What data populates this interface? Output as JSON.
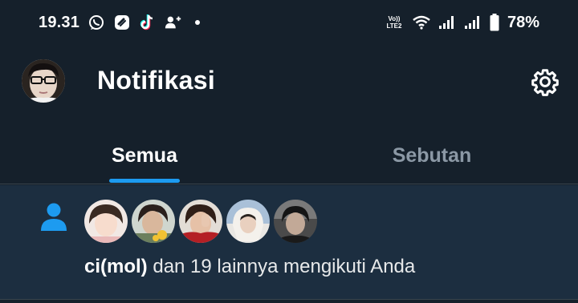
{
  "status_bar": {
    "time": "19.31",
    "battery": "78%",
    "icons": [
      "whatsapp-icon",
      "link-app-icon",
      "tiktok-icon",
      "add-person-icon",
      "notification-dot",
      "volte-icon",
      "wifi-icon",
      "signal-icon",
      "signal-icon",
      "battery-icon"
    ],
    "volte_line1": "Vo))",
    "volte_line2": "LTE2"
  },
  "header": {
    "title": "Notifikasi"
  },
  "tabs": [
    {
      "label": "Semua",
      "active": true
    },
    {
      "label": "Sebutan",
      "active": false
    }
  ],
  "notification": {
    "icon": "person-icon",
    "user": "ci(mol)",
    "text": " dan 19 lainnya mengikuti Anda",
    "follower_avatars": 5
  },
  "colors": {
    "background": "#15202b",
    "notification_bg": "#1c2e40",
    "accent": "#1d9bf0",
    "muted_text": "#8b98a5",
    "divider": "#38444d"
  }
}
